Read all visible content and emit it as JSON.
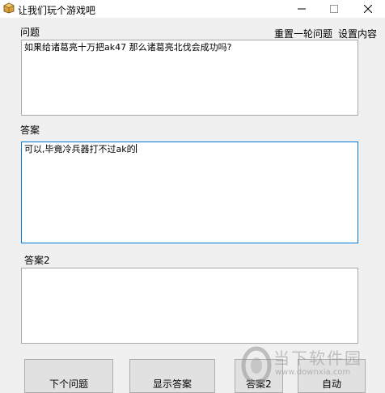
{
  "window": {
    "title": "让我们玩个游戏吧",
    "icon": "package-icon"
  },
  "question": {
    "label": "问题",
    "value": "如果给诸葛亮十万把ak47 那么诸葛亮北伐会成功吗?"
  },
  "links": {
    "reset": "重置一轮问题",
    "settings": "设置内容"
  },
  "answer": {
    "label": "答案",
    "value": "可以,毕竟冷兵器打不过ak的"
  },
  "answer2": {
    "label": "答案2",
    "value": ""
  },
  "buttons": {
    "next": "下个问题",
    "show": "显示答案",
    "answer2": "答案2",
    "auto": "自动"
  },
  "watermark": {
    "brand": "当下软件园",
    "url": "www.downxia.com"
  }
}
